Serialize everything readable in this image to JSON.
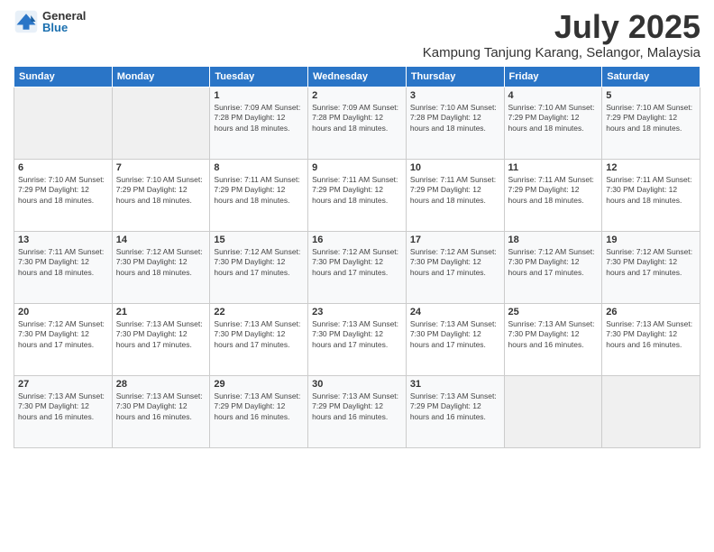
{
  "logo": {
    "general": "General",
    "blue": "Blue"
  },
  "title": "July 2025",
  "location": "Kampung Tanjung Karang, Selangor, Malaysia",
  "days_header": [
    "Sunday",
    "Monday",
    "Tuesday",
    "Wednesday",
    "Thursday",
    "Friday",
    "Saturday"
  ],
  "weeks": [
    [
      {
        "day": "",
        "info": ""
      },
      {
        "day": "",
        "info": ""
      },
      {
        "day": "1",
        "info": "Sunrise: 7:09 AM\nSunset: 7:28 PM\nDaylight: 12 hours and 18 minutes."
      },
      {
        "day": "2",
        "info": "Sunrise: 7:09 AM\nSunset: 7:28 PM\nDaylight: 12 hours and 18 minutes."
      },
      {
        "day": "3",
        "info": "Sunrise: 7:10 AM\nSunset: 7:28 PM\nDaylight: 12 hours and 18 minutes."
      },
      {
        "day": "4",
        "info": "Sunrise: 7:10 AM\nSunset: 7:29 PM\nDaylight: 12 hours and 18 minutes."
      },
      {
        "day": "5",
        "info": "Sunrise: 7:10 AM\nSunset: 7:29 PM\nDaylight: 12 hours and 18 minutes."
      }
    ],
    [
      {
        "day": "6",
        "info": "Sunrise: 7:10 AM\nSunset: 7:29 PM\nDaylight: 12 hours and 18 minutes."
      },
      {
        "day": "7",
        "info": "Sunrise: 7:10 AM\nSunset: 7:29 PM\nDaylight: 12 hours and 18 minutes."
      },
      {
        "day": "8",
        "info": "Sunrise: 7:11 AM\nSunset: 7:29 PM\nDaylight: 12 hours and 18 minutes."
      },
      {
        "day": "9",
        "info": "Sunrise: 7:11 AM\nSunset: 7:29 PM\nDaylight: 12 hours and 18 minutes."
      },
      {
        "day": "10",
        "info": "Sunrise: 7:11 AM\nSunset: 7:29 PM\nDaylight: 12 hours and 18 minutes."
      },
      {
        "day": "11",
        "info": "Sunrise: 7:11 AM\nSunset: 7:29 PM\nDaylight: 12 hours and 18 minutes."
      },
      {
        "day": "12",
        "info": "Sunrise: 7:11 AM\nSunset: 7:30 PM\nDaylight: 12 hours and 18 minutes."
      }
    ],
    [
      {
        "day": "13",
        "info": "Sunrise: 7:11 AM\nSunset: 7:30 PM\nDaylight: 12 hours and 18 minutes."
      },
      {
        "day": "14",
        "info": "Sunrise: 7:12 AM\nSunset: 7:30 PM\nDaylight: 12 hours and 18 minutes."
      },
      {
        "day": "15",
        "info": "Sunrise: 7:12 AM\nSunset: 7:30 PM\nDaylight: 12 hours and 17 minutes."
      },
      {
        "day": "16",
        "info": "Sunrise: 7:12 AM\nSunset: 7:30 PM\nDaylight: 12 hours and 17 minutes."
      },
      {
        "day": "17",
        "info": "Sunrise: 7:12 AM\nSunset: 7:30 PM\nDaylight: 12 hours and 17 minutes."
      },
      {
        "day": "18",
        "info": "Sunrise: 7:12 AM\nSunset: 7:30 PM\nDaylight: 12 hours and 17 minutes."
      },
      {
        "day": "19",
        "info": "Sunrise: 7:12 AM\nSunset: 7:30 PM\nDaylight: 12 hours and 17 minutes."
      }
    ],
    [
      {
        "day": "20",
        "info": "Sunrise: 7:12 AM\nSunset: 7:30 PM\nDaylight: 12 hours and 17 minutes."
      },
      {
        "day": "21",
        "info": "Sunrise: 7:13 AM\nSunset: 7:30 PM\nDaylight: 12 hours and 17 minutes."
      },
      {
        "day": "22",
        "info": "Sunrise: 7:13 AM\nSunset: 7:30 PM\nDaylight: 12 hours and 17 minutes."
      },
      {
        "day": "23",
        "info": "Sunrise: 7:13 AM\nSunset: 7:30 PM\nDaylight: 12 hours and 17 minutes."
      },
      {
        "day": "24",
        "info": "Sunrise: 7:13 AM\nSunset: 7:30 PM\nDaylight: 12 hours and 17 minutes."
      },
      {
        "day": "25",
        "info": "Sunrise: 7:13 AM\nSunset: 7:30 PM\nDaylight: 12 hours and 16 minutes."
      },
      {
        "day": "26",
        "info": "Sunrise: 7:13 AM\nSunset: 7:30 PM\nDaylight: 12 hours and 16 minutes."
      }
    ],
    [
      {
        "day": "27",
        "info": "Sunrise: 7:13 AM\nSunset: 7:30 PM\nDaylight: 12 hours and 16 minutes."
      },
      {
        "day": "28",
        "info": "Sunrise: 7:13 AM\nSunset: 7:30 PM\nDaylight: 12 hours and 16 minutes."
      },
      {
        "day": "29",
        "info": "Sunrise: 7:13 AM\nSunset: 7:29 PM\nDaylight: 12 hours and 16 minutes."
      },
      {
        "day": "30",
        "info": "Sunrise: 7:13 AM\nSunset: 7:29 PM\nDaylight: 12 hours and 16 minutes."
      },
      {
        "day": "31",
        "info": "Sunrise: 7:13 AM\nSunset: 7:29 PM\nDaylight: 12 hours and 16 minutes."
      },
      {
        "day": "",
        "info": ""
      },
      {
        "day": "",
        "info": ""
      }
    ]
  ]
}
